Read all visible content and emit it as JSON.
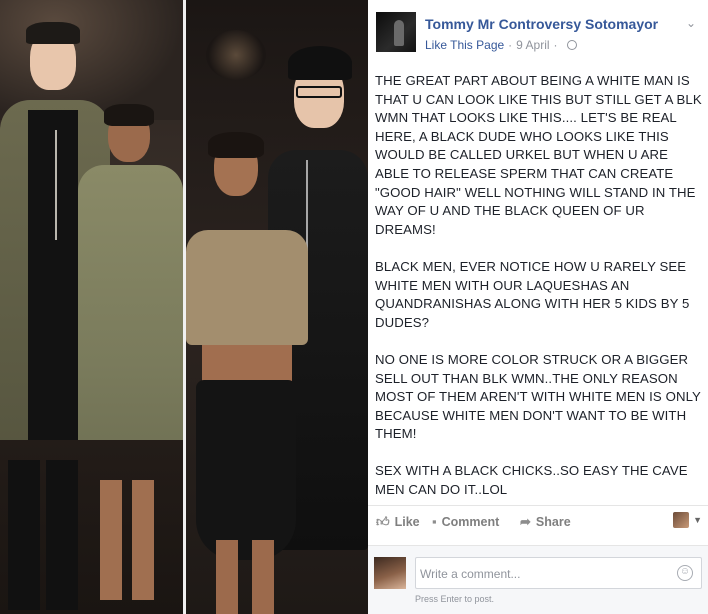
{
  "post": {
    "page_name": "Tommy Mr Controversy Sotomayor",
    "like_page": "Like This Page",
    "separator": "·",
    "date": "9 April",
    "separator2": "·",
    "paragraphs": [
      "THE GREAT PART ABOUT BEING A WHITE MAN IS THAT U CAN LOOK LIKE THIS BUT STILL GET A BLK WMN THAT LOOKS LIKE THIS.... LET'S BE REAL HERE, A BLACK DUDE WHO LOOKS LIKE THIS WOULD BE CALLED URKEL BUT WHEN U ARE ABLE TO RELEASE SPERM THAT CAN CREATE \"GOOD HAIR\" WELL NOTHING WILL STAND IN THE WAY OF U AND THE BLACK QUEEN OF UR DREAMS!",
      "BLACK MEN, EVER NOTICE HOW U RARELY SEE WHITE MEN WITH OUR LAQUESHAS AN QUANDRANISHAS ALONG WITH HER 5 KIDS BY 5 DUDES?",
      "NO ONE IS MORE COLOR STRUCK OR A BIGGER SELL OUT THAN BLK WMN..THE ONLY REASON MOST OF THEM AREN'T WITH WHITE MEN IS ONLY BECAUSE WHITE MEN DON'T WANT TO BE WITH THEM!",
      "SEX WITH A BLACK CHICKS..SO EASY THE CAVE MEN CAN DO IT..LOL"
    ]
  },
  "actions": {
    "like": "Like",
    "comment": "Comment",
    "share": "Share"
  },
  "comment_box": {
    "placeholder": "Write a comment...",
    "hint": "Press Enter to post."
  },
  "icons": {
    "chevron": "chevron-down-icon",
    "globe": "globe-icon",
    "like": "thumbs-up-icon",
    "comment": "speech-bubble-icon",
    "share": "share-arrow-icon",
    "emoji": "smiley-icon"
  },
  "colors": {
    "link": "#365899",
    "text": "#1d2129",
    "muted": "#90949c",
    "action": "#7f7f7f"
  }
}
